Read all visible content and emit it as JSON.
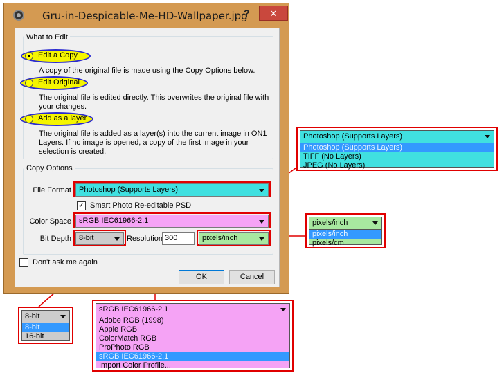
{
  "window": {
    "title": "Gru-in-Despicable-Me-HD-Wallpaper.jpg",
    "help_label": "?",
    "close_label": "✕"
  },
  "what_to_edit": {
    "title": "What to Edit",
    "options": [
      {
        "label": "Edit a Copy",
        "checked": true,
        "description": "A copy of the original file is made using the Copy Options below."
      },
      {
        "label": "Edit Original",
        "checked": false,
        "description": "The original file is edited directly.  This overwrites the original file with your changes."
      },
      {
        "label": "Add as a layer",
        "checked": false,
        "description": "The original file is added as a layer(s) into the current image in ON1 Layers.  If no image is opened, a copy of the first image in your selection is created."
      }
    ]
  },
  "copy_options": {
    "title": "Copy Options",
    "file_format_label": "File Format",
    "file_format_value": "Photoshop (Supports Layers)",
    "smart_photo_label": "Smart Photo Re-editable PSD",
    "smart_photo_checked": true,
    "color_space_label": "Color Space",
    "color_space_value": "sRGB IEC61966-2.1",
    "bit_depth_label": "Bit Depth",
    "bit_depth_value": "8-bit",
    "resolution_label": "Resolution",
    "resolution_value": "300",
    "resolution_unit_value": "pixels/inch"
  },
  "dont_ask": {
    "label": "Don't ask me again",
    "checked": false
  },
  "buttons": {
    "ok": "OK",
    "cancel": "Cancel"
  },
  "callouts": {
    "file_format": {
      "selected": "Photoshop (Supports Layers)",
      "options": [
        "Photoshop (Supports Layers)",
        "TIFF (No Layers)",
        "JPEG (No Layers)"
      ],
      "selected_index": 0
    },
    "resolution_unit": {
      "selected": "pixels/inch",
      "options": [
        "pixels/inch",
        "pixels/cm"
      ],
      "selected_index": 0
    },
    "bit_depth": {
      "selected": "8-bit",
      "options": [
        "8-bit",
        "16-bit"
      ],
      "selected_index": 0
    },
    "color_space": {
      "selected": "sRGB IEC61966-2.1",
      "options": [
        "Adobe RGB (1998)",
        "Apple RGB",
        "ColorMatch RGB",
        "ProPhoto RGB",
        "sRGB IEC61966-2.1",
        "Import Color Profile..."
      ],
      "selected_index": 4
    }
  },
  "colors": {
    "window_frame": "#d49a52",
    "highlight_yellow": "#ffff00",
    "oval_blue": "#2a2ad0",
    "annotation_red": "#e00000",
    "file_format_cyan": "#40e0e0",
    "color_space_pink": "#f5a3f5",
    "bit_depth_gray": "#cccccc",
    "resolution_green": "#a8e8a0",
    "selection_blue": "#3399ff"
  }
}
